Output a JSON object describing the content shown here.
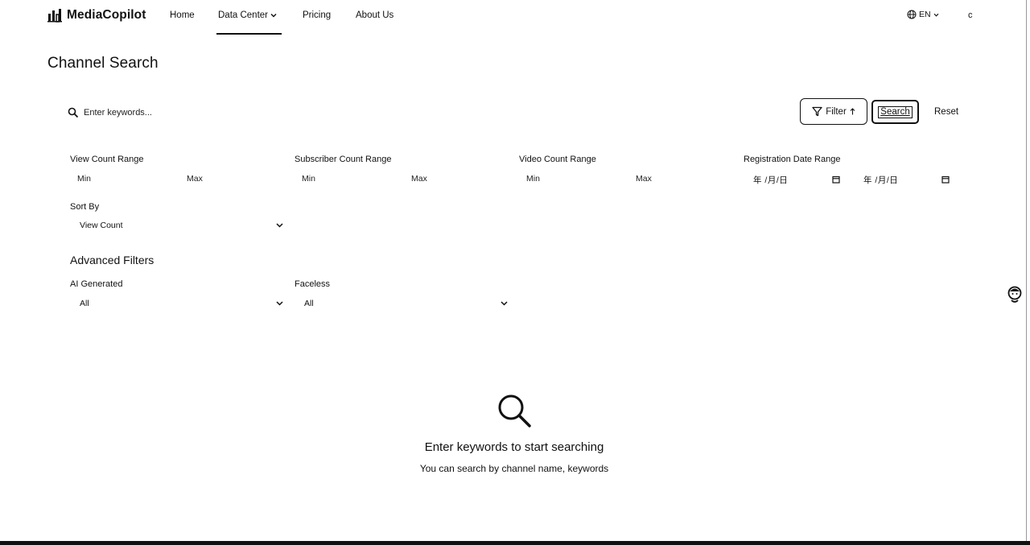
{
  "header": {
    "logo_text": "MediaCopilot",
    "logo_icon": "bar-chart-logo-icon",
    "nav": {
      "home": "Home",
      "data_center": "Data Center",
      "pricing": "Pricing",
      "about": "About Us",
      "active": "Data Center"
    },
    "language": "EN",
    "language_icon": "globe-icon",
    "user_initial": "c"
  },
  "page": {
    "title": "Channel Search"
  },
  "search": {
    "placeholder": "Enter keywords...",
    "value": "",
    "filter_label": "Filter",
    "search_label": "Search",
    "reset_label": "Reset"
  },
  "filters": {
    "view_count": {
      "label": "View Count Range",
      "min_placeholder": "Min",
      "max_placeholder": "Max"
    },
    "subscriber_count": {
      "label": "Subscriber Count Range",
      "min_placeholder": "Min",
      "max_placeholder": "Max"
    },
    "video_count": {
      "label": "Video Count Range",
      "min_placeholder": "Min",
      "max_placeholder": "Max"
    },
    "registration_date": {
      "label": "Registration Date Range",
      "start_placeholder": "年 /月/日",
      "end_placeholder": "年 /月/日"
    },
    "sort_by": {
      "label": "Sort By",
      "value": "View Count"
    }
  },
  "advanced": {
    "title": "Advanced Filters",
    "ai_generated": {
      "label": "AI Generated",
      "value": "All"
    },
    "faceless": {
      "label": "Faceless",
      "value": "All"
    }
  },
  "empty_state": {
    "icon": "magnifier-icon",
    "title": "Enter keywords to start searching",
    "subtitle": "You can search by channel name, keywords"
  },
  "colors": {
    "text": "#111111",
    "background": "#ffffff"
  }
}
